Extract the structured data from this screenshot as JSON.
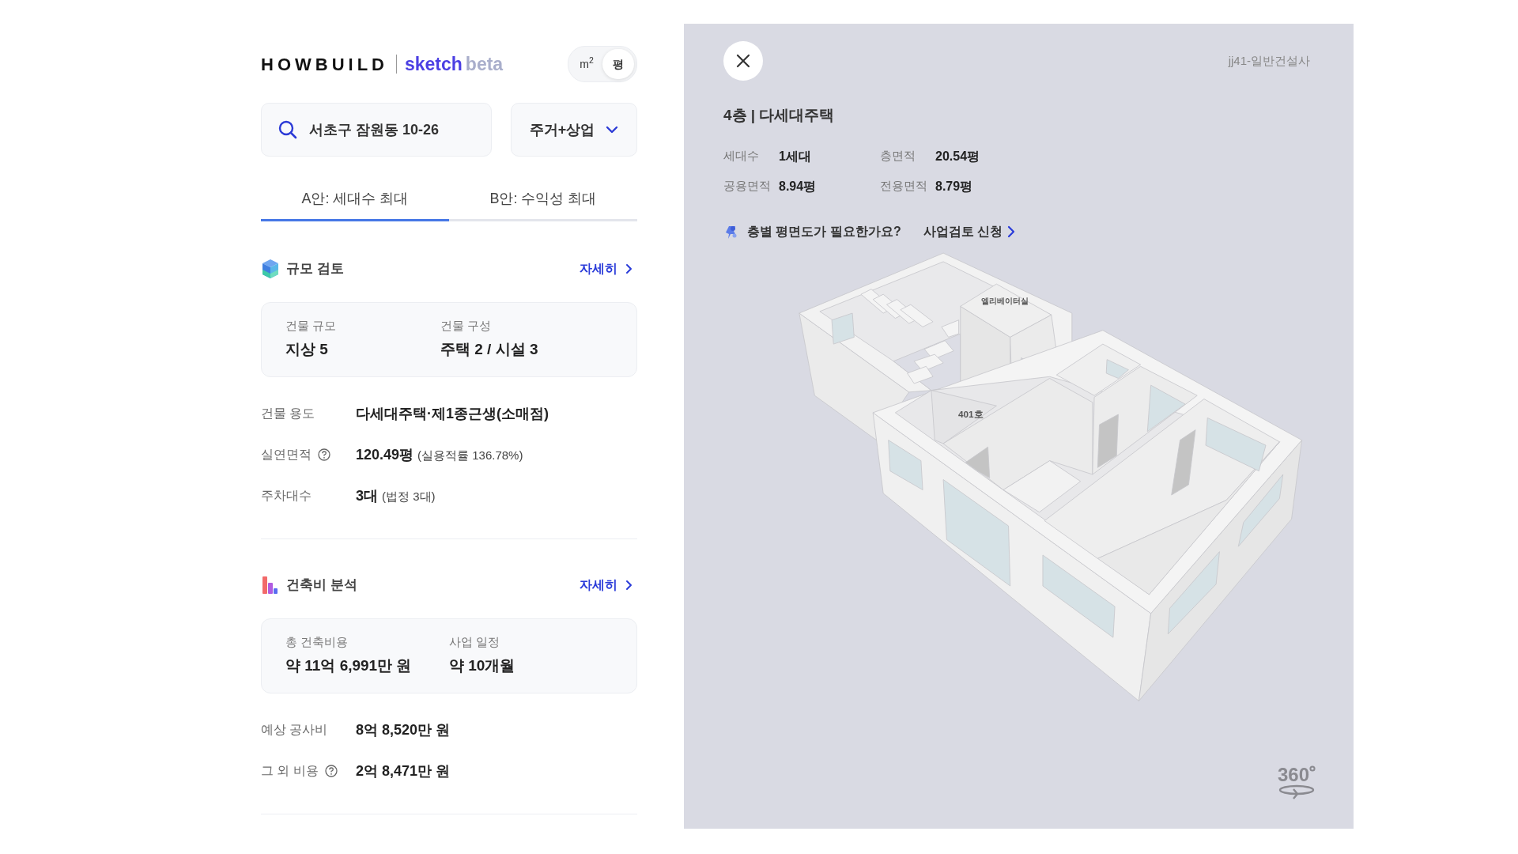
{
  "header": {
    "brand": "HOWBUILD",
    "product": "sketch",
    "badge": "beta",
    "units": [
      {
        "label": "m$^{2}$",
        "selected": false
      },
      {
        "label": "평",
        "selected": true
      }
    ]
  },
  "search": {
    "value": "서초구 잠원동 10-26"
  },
  "use_select": {
    "value": "주거+상업"
  },
  "tabs": [
    {
      "label": "A안: 세대수 최대",
      "selected": true
    },
    {
      "label": "B안: 수익성 최대",
      "selected": false
    }
  ],
  "sections": [
    {
      "kind": "scale",
      "title": "규모 검토",
      "link": "자세히",
      "summary": [
        {
          "label": "건물 규모",
          "value": "지상 5"
        },
        {
          "label": "건물 구성",
          "value": "주택 2 / 시설 3"
        }
      ],
      "rows": [
        {
          "label": "건물 용도",
          "help": false,
          "value": "다세대주택·제1종근생(소매점)"
        },
        {
          "label": "실연면적",
          "help": true,
          "value": "120.49평",
          "note": "(실용적률 136.78%)"
        },
        {
          "label": "주차대수",
          "help": false,
          "value": "3대",
          "note": "(법정 3대)"
        }
      ]
    },
    {
      "kind": "cost",
      "title": "건축비 분석",
      "link": "자세히",
      "summary": [
        {
          "label": "총 건축비용",
          "value": "약 11억 6,991만 원"
        },
        {
          "label": "사업 일정",
          "value": "약 10개월"
        }
      ],
      "rows": [
        {
          "label": "예상 공사비",
          "help": false,
          "value": "8억 8,520만 원"
        },
        {
          "label": "그 외 비용",
          "help": true,
          "value": "2억 8,471만 원"
        }
      ]
    }
  ],
  "detail": {
    "company": "jj41-일반건설사",
    "title": "4층 | 다세대주택",
    "stats": [
      {
        "label": "세대수",
        "value": "1세대"
      },
      {
        "label": "층면적",
        "value": "20.54평"
      },
      {
        "label": "공용면적",
        "value": "8.94평"
      },
      {
        "label": "전용면적",
        "value": "8.79평"
      }
    ],
    "cta": {
      "question": "층별 평면도가 필요한가요?",
      "link": "사업검토 신청"
    },
    "model_labels": [
      {
        "text": "엘리베이터실"
      },
      {
        "text": "401호"
      }
    ],
    "rotate_label": "360"
  }
}
